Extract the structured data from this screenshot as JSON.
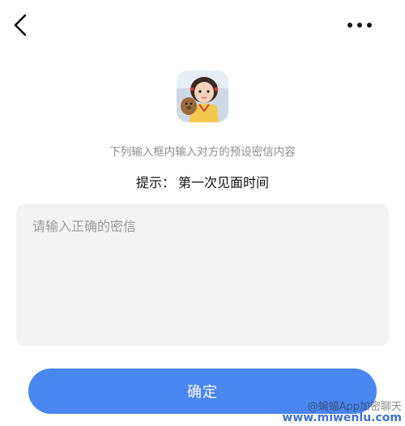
{
  "nav": {
    "back_icon": "chevron-left-icon",
    "more_icon": "ellipsis-icon"
  },
  "avatar": {
    "description_icon": "avatar-photo"
  },
  "prompt": {
    "instruction": "下列输入框内输入对方的预设密信内容",
    "tip_label": "提示：",
    "tip_answer": "第一次见面时间"
  },
  "input": {
    "value": "",
    "placeholder": "请输入正确的密信"
  },
  "button": {
    "confirm_label": "确定"
  },
  "watermark": {
    "line1": "@蝙蝠App加密聊天",
    "line2": "www.miwenlu.com"
  },
  "colors": {
    "accent": "#4a86f0",
    "input_bg": "#f3f3f3",
    "hint_text": "#8c8c8c"
  }
}
